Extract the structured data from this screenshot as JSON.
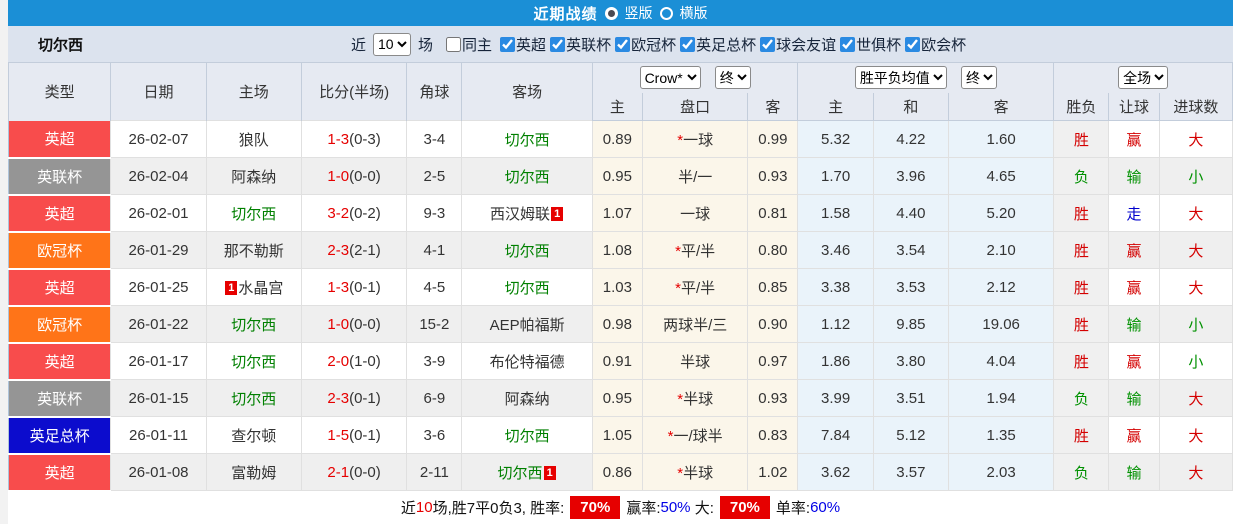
{
  "top_bar": {
    "title": "近期战绩",
    "view_options": [
      {
        "label": "竖版",
        "selected": true
      },
      {
        "label": "横版",
        "selected": false
      }
    ]
  },
  "filter_bar": {
    "team": "切尔西",
    "recent_label": "近",
    "recent_value": "10",
    "recent_suffix": "场",
    "checkboxes": [
      {
        "label": "同主",
        "checked": false
      },
      {
        "label": "英超",
        "checked": true
      },
      {
        "label": "英联杯",
        "checked": true
      },
      {
        "label": "欧冠杯",
        "checked": true
      },
      {
        "label": "英足总杯",
        "checked": true
      },
      {
        "label": "球会友谊",
        "checked": true
      },
      {
        "label": "世俱杯",
        "checked": true
      },
      {
        "label": "欧会杯",
        "checked": true
      }
    ]
  },
  "table": {
    "headers_left": [
      "类型",
      "日期",
      "主场",
      "比分(半场)",
      "角球",
      "客场"
    ],
    "selects": {
      "bookmaker": "Crow*",
      "bookmaker_period": "终",
      "europe": "胜平负均值",
      "europe_period": "终",
      "scope": "全场"
    },
    "sub_headers": [
      "主",
      "盘口",
      "客",
      "主",
      "和",
      "客",
      "胜负",
      "让球",
      "进球数"
    ],
    "type_colors": {
      "英超": "#f84c4c",
      "英联杯": "#959595",
      "欧冠杯": "#ff7418",
      "英足总杯": "#0c0ccd"
    },
    "chelsea_color": "#008000",
    "score_color": "#e60000",
    "rows": [
      {
        "type": "英超",
        "date": "26-02-07",
        "home": "狼队",
        "home_is_chelsea": false,
        "home_card": "",
        "home_card_pos": "",
        "score": "1-3",
        "half": "(0-3)",
        "corner": "3-4",
        "away": "切尔西",
        "away_is_chelsea": true,
        "away_card": "",
        "away_card_pos": "",
        "asian_home": "0.89",
        "handicap": "*一球",
        "asian_away": "0.99",
        "euro_home": "5.32",
        "euro_draw": "4.22",
        "euro_away": "1.60",
        "result": "胜",
        "handicap_result": "赢",
        "goals": "大"
      },
      {
        "type": "英联杯",
        "date": "26-02-04",
        "home": "阿森纳",
        "home_is_chelsea": false,
        "home_card": "",
        "home_card_pos": "",
        "score": "1-0",
        "half": "(0-0)",
        "corner": "2-5",
        "away": "切尔西",
        "away_is_chelsea": true,
        "away_card": "",
        "away_card_pos": "",
        "asian_home": "0.95",
        "handicap": "半/一",
        "asian_away": "0.93",
        "euro_home": "1.70",
        "euro_draw": "3.96",
        "euro_away": "4.65",
        "result": "负",
        "handicap_result": "输",
        "goals": "小"
      },
      {
        "type": "英超",
        "date": "26-02-01",
        "home": "切尔西",
        "home_is_chelsea": true,
        "home_card": "",
        "home_card_pos": "",
        "score": "3-2",
        "half": "(0-2)",
        "corner": "9-3",
        "away": "西汉姆联",
        "away_is_chelsea": false,
        "away_card": "1",
        "away_card_pos": "after",
        "asian_home": "1.07",
        "handicap": "一球",
        "asian_away": "0.81",
        "euro_home": "1.58",
        "euro_draw": "4.40",
        "euro_away": "5.20",
        "result": "胜",
        "handicap_result": "走",
        "goals": "大"
      },
      {
        "type": "欧冠杯",
        "date": "26-01-29",
        "home": "那不勒斯",
        "home_is_chelsea": false,
        "home_card": "",
        "home_card_pos": "",
        "score": "2-3",
        "half": "(2-1)",
        "corner": "4-1",
        "away": "切尔西",
        "away_is_chelsea": true,
        "away_card": "",
        "away_card_pos": "",
        "asian_home": "1.08",
        "handicap": "*平/半",
        "asian_away": "0.80",
        "euro_home": "3.46",
        "euro_draw": "3.54",
        "euro_away": "2.10",
        "result": "胜",
        "handicap_result": "赢",
        "goals": "大"
      },
      {
        "type": "英超",
        "date": "26-01-25",
        "home": "水晶宫",
        "home_is_chelsea": false,
        "home_card": "1",
        "home_card_pos": "before",
        "score": "1-3",
        "half": "(0-1)",
        "corner": "4-5",
        "away": "切尔西",
        "away_is_chelsea": true,
        "away_card": "",
        "away_card_pos": "",
        "asian_home": "1.03",
        "handicap": "*平/半",
        "asian_away": "0.85",
        "euro_home": "3.38",
        "euro_draw": "3.53",
        "euro_away": "2.12",
        "result": "胜",
        "handicap_result": "赢",
        "goals": "大"
      },
      {
        "type": "欧冠杯",
        "date": "26-01-22",
        "home": "切尔西",
        "home_is_chelsea": true,
        "home_card": "",
        "home_card_pos": "",
        "score": "1-0",
        "half": "(0-0)",
        "corner": "15-2",
        "away": "AEP帕福斯",
        "away_is_chelsea": false,
        "away_card": "",
        "away_card_pos": "",
        "asian_home": "0.98",
        "handicap": "两球半/三",
        "asian_away": "0.90",
        "euro_home": "1.12",
        "euro_draw": "9.85",
        "euro_away": "19.06",
        "result": "胜",
        "handicap_result": "输",
        "goals": "小"
      },
      {
        "type": "英超",
        "date": "26-01-17",
        "home": "切尔西",
        "home_is_chelsea": true,
        "home_card": "",
        "home_card_pos": "",
        "score": "2-0",
        "half": "(1-0)",
        "corner": "3-9",
        "away": "布伦特福德",
        "away_is_chelsea": false,
        "away_card": "",
        "away_card_pos": "",
        "asian_home": "0.91",
        "handicap": "半球",
        "asian_away": "0.97",
        "euro_home": "1.86",
        "euro_draw": "3.80",
        "euro_away": "4.04",
        "result": "胜",
        "handicap_result": "赢",
        "goals": "小"
      },
      {
        "type": "英联杯",
        "date": "26-01-15",
        "home": "切尔西",
        "home_is_chelsea": true,
        "home_card": "",
        "home_card_pos": "",
        "score": "2-3",
        "half": "(0-1)",
        "corner": "6-9",
        "away": "阿森纳",
        "away_is_chelsea": false,
        "away_card": "",
        "away_card_pos": "",
        "asian_home": "0.95",
        "handicap": "*半球",
        "asian_away": "0.93",
        "euro_home": "3.99",
        "euro_draw": "3.51",
        "euro_away": "1.94",
        "result": "负",
        "handicap_result": "输",
        "goals": "大"
      },
      {
        "type": "英足总杯",
        "date": "26-01-11",
        "home": "查尔顿",
        "home_is_chelsea": false,
        "home_card": "",
        "home_card_pos": "",
        "score": "1-5",
        "half": "(0-1)",
        "corner": "3-6",
        "away": "切尔西",
        "away_is_chelsea": true,
        "away_card": "",
        "away_card_pos": "",
        "asian_home": "1.05",
        "handicap": "*一/球半",
        "asian_away": "0.83",
        "euro_home": "7.84",
        "euro_draw": "5.12",
        "euro_away": "1.35",
        "result": "胜",
        "handicap_result": "赢",
        "goals": "大"
      },
      {
        "type": "英超",
        "date": "26-01-08",
        "home": "富勒姆",
        "home_is_chelsea": false,
        "home_card": "",
        "home_card_pos": "",
        "score": "2-1",
        "half": "(0-0)",
        "corner": "2-11",
        "away": "切尔西",
        "away_is_chelsea": true,
        "away_card": "1",
        "away_card_pos": "after",
        "asian_home": "0.86",
        "handicap": "*半球",
        "asian_away": "1.02",
        "euro_home": "3.62",
        "euro_draw": "3.57",
        "euro_away": "2.03",
        "result": "负",
        "handicap_result": "输",
        "goals": "大"
      }
    ]
  },
  "footer": {
    "prefix": "近",
    "count": "10",
    "summary": "场,胜7平0负3, 胜率:",
    "win_rate": "70%",
    "win_odds_label": "赢率:",
    "win_odds": "50%",
    "big_label": "大:",
    "big_rate": "70%",
    "single_label": "单率:",
    "single_rate": "60%"
  }
}
